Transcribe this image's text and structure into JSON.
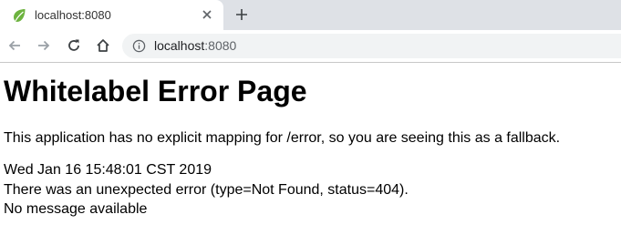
{
  "browser": {
    "tab": {
      "title": "localhost:8080",
      "favicon": "spring-leaf-icon",
      "favicon_color": "#6db33f"
    },
    "new_tab_label": "+",
    "address_bar": {
      "host": "localhost",
      "port": ":8080",
      "icon": "info-icon"
    },
    "nav_icons": [
      "back-icon",
      "forward-icon",
      "reload-icon",
      "home-icon"
    ]
  },
  "page": {
    "heading": "Whitelabel Error Page",
    "message": "This application has no explicit mapping for /error, so you are seeing this as a fallback.",
    "timestamp": "Wed Jan 16 15:48:01 CST 2019",
    "error_line": "There was an unexpected error (type=Not Found, status=404).",
    "detail": "No message available"
  }
}
